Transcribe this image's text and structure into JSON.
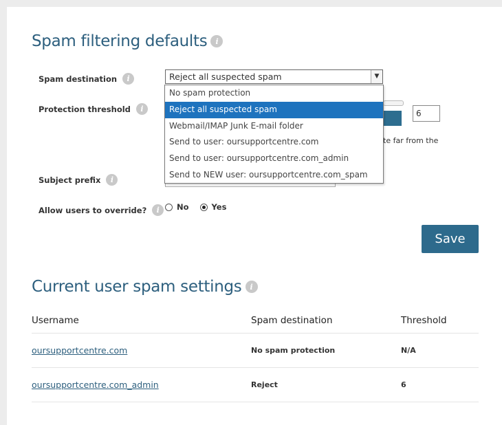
{
  "defaults": {
    "title": "Spam filtering defaults",
    "spam_destination": {
      "label": "Spam destination",
      "selected": "Reject all suspected spam",
      "options": [
        "No spam protection",
        "Reject all suspected spam",
        "Webmail/IMAP Junk E-mail folder",
        "Send to user: oursupportcentre.com",
        "Send to user: oursupportcentre.com_admin",
        "Send to NEW user: oursupportcentre.com_spam"
      ],
      "highlighted_index": 1
    },
    "protection_threshold": {
      "label": "Protection threshold",
      "value": "6",
      "partial_hint": "te far from the"
    },
    "subject_prefix": {
      "label": "Subject prefix"
    },
    "allow_override": {
      "label": "Allow users to override?",
      "options": [
        "No",
        "Yes"
      ],
      "selected": "Yes"
    },
    "save_label": "Save"
  },
  "current": {
    "title": "Current user spam settings",
    "columns": [
      "Username",
      "Spam destination",
      "Threshold"
    ],
    "rows": [
      {
        "username": "oursupportcentre.com",
        "destination": "No spam protection",
        "threshold": "N/A"
      },
      {
        "username": "oursupportcentre.com_admin",
        "destination": "Reject",
        "threshold": "6"
      }
    ]
  },
  "colors": {
    "heading": "#2d5f7e",
    "button": "#2d6a8c",
    "highlight": "#1e73be"
  },
  "icons": {
    "info": "info-icon",
    "dropdown": "chevron-down-icon"
  }
}
